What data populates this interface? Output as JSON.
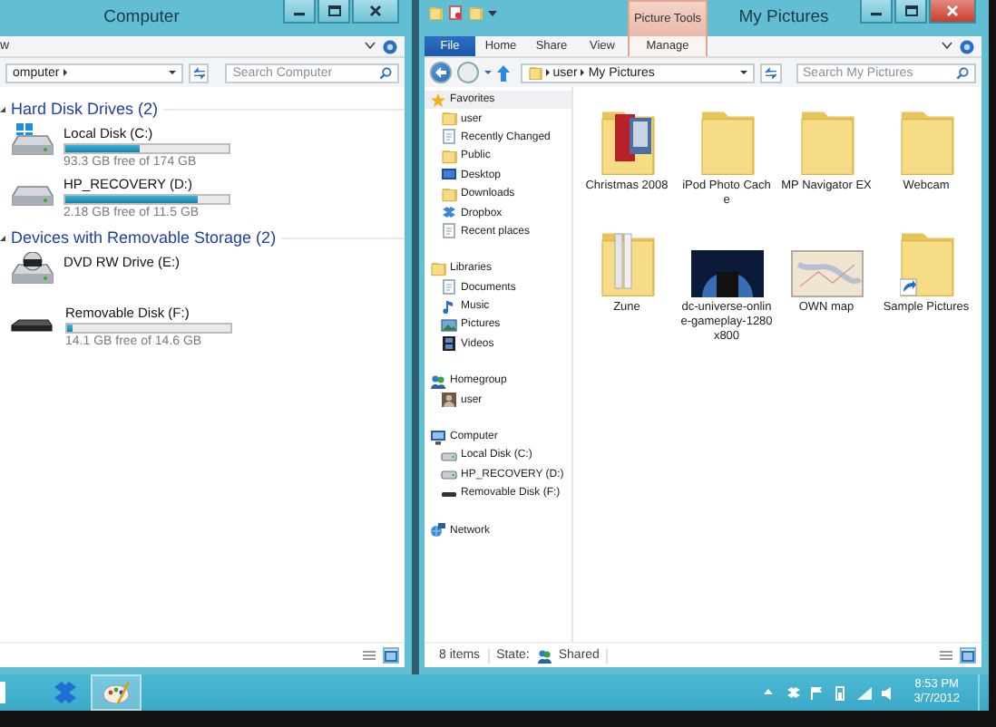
{
  "left_window": {
    "title": "Computer",
    "ribbon_tab": "w",
    "address": "omputer",
    "search": {
      "placeholder": "Search Computer"
    },
    "groups": [
      {
        "title": "Hard Disk Drives (2)",
        "expanded": true,
        "items": [
          {
            "kind": "system-disk",
            "name": "Local Disk (C:)",
            "level": 0.46,
            "detail": "93.3 GB free of 174 GB"
          },
          {
            "kind": "disk",
            "name": "HP_RECOVERY (D:)",
            "level": 0.81,
            "detail": "2.18 GB free of 11.5 GB"
          }
        ]
      },
      {
        "title": "Devices with Removable Storage (2)",
        "expanded": true,
        "items": [
          {
            "kind": "dvd",
            "name": "DVD RW Drive (E:)"
          },
          {
            "kind": "removable",
            "name": "Removable Disk (F:)",
            "level": 0.03,
            "detail": "14.1 GB free of 14.6 GB"
          }
        ]
      }
    ],
    "view_buttons": [
      {
        "kind": "details",
        "selected": false
      },
      {
        "kind": "large-icons",
        "selected": true
      }
    ]
  },
  "right_window": {
    "title": "My Pictures",
    "context_group": "Picture Tools",
    "tabs": [
      {
        "label": "File",
        "kind": "file"
      },
      {
        "label": "Home",
        "kind": "normal"
      },
      {
        "label": "Share",
        "kind": "normal"
      },
      {
        "label": "View",
        "kind": "normal"
      },
      {
        "label": "Manage",
        "kind": "context"
      }
    ],
    "address": [
      "user",
      "My Pictures"
    ],
    "search": {
      "placeholder": "Search My Pictures"
    },
    "nav": [
      {
        "label": "Favorites",
        "kind": "star",
        "selected": true,
        "children": [
          {
            "label": "user",
            "kind": "folder",
            "selected": false
          },
          {
            "label": "Recently Changed",
            "kind": "document",
            "selected": false
          },
          {
            "label": "Public",
            "kind": "folder",
            "selected": false
          },
          {
            "label": "Desktop",
            "kind": "desktop",
            "selected": false
          },
          {
            "label": "Downloads",
            "kind": "folder",
            "selected": false
          },
          {
            "label": "Dropbox",
            "kind": "box",
            "selected": false
          },
          {
            "label": "Recent places",
            "kind": "document",
            "selected": false
          }
        ]
      },
      {
        "label": "Libraries",
        "kind": "folder",
        "selected": false,
        "children": [
          {
            "label": "Documents",
            "kind": "document",
            "selected": false
          },
          {
            "label": "Music",
            "kind": "music",
            "selected": false
          },
          {
            "label": "Pictures",
            "kind": "picture",
            "selected": false
          },
          {
            "label": "Videos",
            "kind": "film",
            "selected": false
          }
        ]
      },
      {
        "label": "Homegroup",
        "kind": "people",
        "selected": false,
        "children": [
          {
            "label": "user",
            "kind": "avatar",
            "selected": false
          }
        ]
      },
      {
        "label": "Computer",
        "kind": "monitor",
        "selected": false,
        "children": [
          {
            "label": "Local Disk (C:)",
            "kind": "drive",
            "selected": false
          },
          {
            "label": "HP_RECOVERY (D:)",
            "kind": "drive",
            "selected": false
          },
          {
            "label": "Removable Disk (F:)",
            "kind": "flat-drive",
            "selected": false
          }
        ]
      },
      {
        "label": "Network",
        "kind": "network",
        "selected": false
      }
    ],
    "items": [
      {
        "label": "Christmas 2008",
        "kind": "photo-folder"
      },
      {
        "label": "iPod Photo Cache",
        "kind": "folder"
      },
      {
        "label": "MP Navigator EX",
        "kind": "folder"
      },
      {
        "label": "Webcam",
        "kind": "folder"
      },
      {
        "label": "Zune",
        "kind": "papers-folder"
      },
      {
        "label": "dc-universe-online-gameplay-1280x800",
        "kind": "image"
      },
      {
        "label": "OWN map",
        "kind": "map"
      },
      {
        "label": "Sample Pictures",
        "kind": "shortcut-folder"
      }
    ],
    "status": {
      "count": "8 items",
      "state_label": "State:",
      "state_value": "Shared"
    },
    "view_buttons": [
      {
        "kind": "details",
        "selected": false
      },
      {
        "kind": "large-icons",
        "selected": true
      }
    ]
  },
  "taskbar": {
    "apps": [
      {
        "kind": "file",
        "selected": false
      },
      {
        "kind": "box",
        "selected": false
      },
      {
        "kind": "paint",
        "selected": true
      }
    ],
    "tray": [
      {
        "kind": "up-arrow"
      },
      {
        "kind": "box"
      },
      {
        "kind": "flag"
      },
      {
        "kind": "power"
      },
      {
        "kind": "signal"
      },
      {
        "kind": "volume"
      }
    ],
    "time": "8:53 PM",
    "date": "3/7/2012"
  }
}
